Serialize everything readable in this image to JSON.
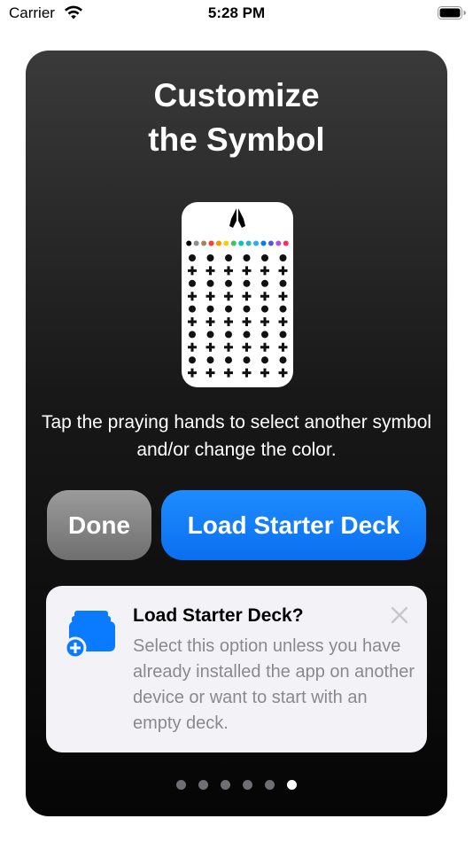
{
  "status_bar": {
    "carrier": "Carrier",
    "time": "5:28 PM"
  },
  "card": {
    "title_line1": "Customize",
    "title_line2": "the Symbol",
    "instructions": "Tap the praying hands to select another symbol and/or change the color.",
    "done_label": "Done",
    "load_label": "Load Starter Deck"
  },
  "tip": {
    "title": "Load Starter Deck?",
    "body": "Select this option unless you have already installed the app on another device or want to start with an empty deck."
  },
  "page_indicator": {
    "count": 6,
    "active_index": 5
  },
  "colors": {
    "accent_blue": "#0a7aff",
    "done_gray": "#8a8a8a",
    "palette": [
      "#000000",
      "#8e8e93",
      "#a2845e",
      "#ff3b30",
      "#ff9500",
      "#ffcc00",
      "#34c759",
      "#00c7be",
      "#30b0c7",
      "#32ade6",
      "#007aff",
      "#5856d6",
      "#af52de",
      "#ff2d55"
    ]
  }
}
